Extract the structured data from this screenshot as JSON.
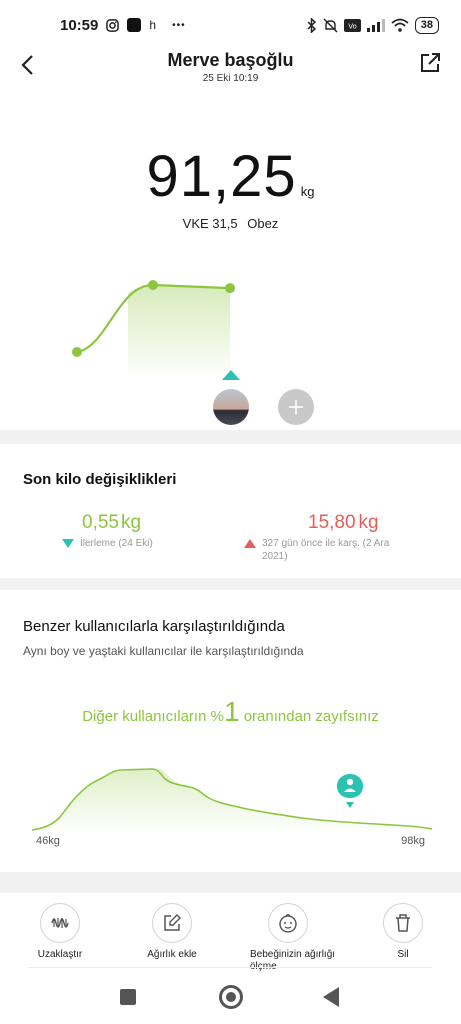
{
  "status_bar": {
    "time": "10:59",
    "left_icons": [
      "instagram-icon",
      "app-icon",
      "h-icon",
      "more-icon"
    ],
    "h_label": "h",
    "more_label": "•••",
    "right_icons": [
      "bluetooth-icon",
      "mute-icon",
      "volte-icon",
      "signal-icon",
      "wifi-icon",
      "battery-icon"
    ],
    "battery": "38"
  },
  "header": {
    "title": "Merve başoğlu",
    "subtitle": "25 Eki 10:19"
  },
  "measurement": {
    "weight": "91,25",
    "unit": "kg",
    "bmi_label": "VKE 31,5",
    "status": "Obez"
  },
  "trend_chart": {
    "points": [
      0.0,
      0.87,
      0.83
    ],
    "color": "#8cc63f"
  },
  "changes": {
    "title": "Son kilo değişiklikleri",
    "left": {
      "value": "0,55",
      "unit": "kg",
      "note": "İlerleme (24 Eki)"
    },
    "right": {
      "value": "15,80",
      "unit": "kg",
      "note": "327 gün önce ile karş. (2 Ara 2021)"
    }
  },
  "compare": {
    "title": "Benzer kullanıcılarla karşılaştırıldığında",
    "subtitle": "Aynı boy ve yaştaki kullanıcılar ile karşılaştırıldığında",
    "headline_prefix": "Diğer kullanıcıların %",
    "headline_number": "1",
    "headline_suffix": " oranından zayıfsınız",
    "axis_min": "46kg",
    "axis_max": "98kg",
    "accent": "#2bc2b1"
  },
  "actions": [
    {
      "label": "Uzaklaştır",
      "icon": "waveform-icon"
    },
    {
      "label": "Ağırlık ekle",
      "icon": "edit-icon"
    },
    {
      "label": "Bebeğinizin ağırlığı ölçme",
      "icon": "baby-icon"
    },
    {
      "label": "Sil",
      "icon": "trash-icon"
    }
  ],
  "colors": {
    "green": "#8cc63f",
    "red": "#e25f5a",
    "teal": "#2bc2b1"
  }
}
